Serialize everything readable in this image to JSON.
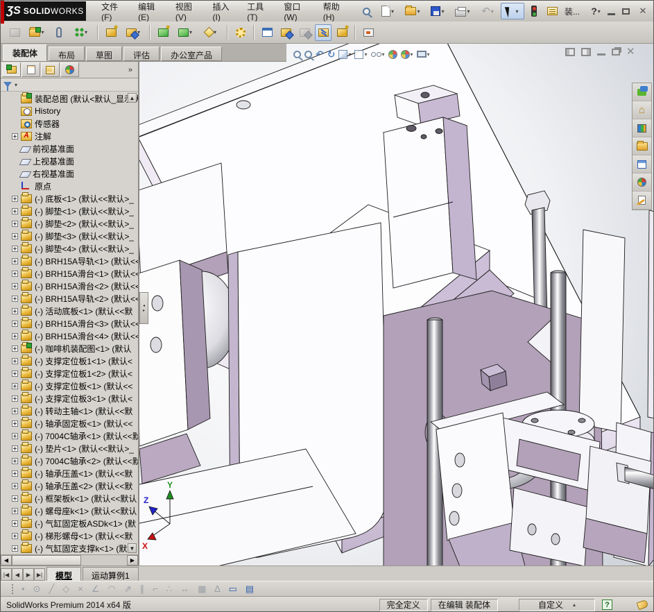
{
  "window": {
    "logo_glyph": "ƷS",
    "logo_brand_bold": "SOLID",
    "logo_brand_light": "WORKS",
    "accent_red": "#c20000",
    "doc_button_label": "装...",
    "help_label": "?"
  },
  "menu": {
    "items": [
      "文件(F)",
      "编辑(E)",
      "视图(V)",
      "插入(I)",
      "工具(T)",
      "窗口(W)",
      "帮助(H)"
    ]
  },
  "quick_toolbar": {
    "icons": [
      "new-document",
      "open",
      "save",
      "print",
      "undo",
      "select-cursor",
      "stoplight-toggle",
      "comment-note",
      "document-menu",
      "help"
    ]
  },
  "assembly_toolbar": {
    "icons": [
      "insert-component",
      "open-part",
      "mate",
      "linear-component-pattern",
      "smart-fasteners",
      "move-component",
      "show-hidden-components",
      "assembly-features",
      "reference-geometry",
      "new-motion-study",
      "bill-of-materials",
      "exploded-view",
      "explode-line-sketch",
      "large-assembly-mode",
      "appearances",
      "take-snapshot"
    ]
  },
  "command_tabs": {
    "items": [
      {
        "label": "装配体",
        "cls": "active"
      },
      {
        "label": "布局",
        "cls": ""
      },
      {
        "label": "草图",
        "cls": ""
      },
      {
        "label": "评估",
        "cls": ""
      },
      {
        "label": "办公室产品",
        "cls": ""
      }
    ]
  },
  "headsup": {
    "icons": [
      "zoom-to-fit",
      "zoom-to-area",
      "previous-view",
      "section-view",
      "view-orientation",
      "display-style",
      "hide-show-items",
      "edit-appearance",
      "apply-scene",
      "view-settings"
    ]
  },
  "doc_window_controls": [
    "split-left",
    "split-right",
    "minimize",
    "restore",
    "close"
  ],
  "feature_tree": {
    "pane_tabs": [
      "feature-manager",
      "property-manager",
      "configuration-manager",
      "display-manager"
    ],
    "more_label": "»",
    "items": [
      {
        "t": "asm",
        "label": "装配总图 (默认<默认_显示状态"
      },
      {
        "t": "hist",
        "label": "History"
      },
      {
        "t": "sens",
        "label": "传感器"
      },
      {
        "t": "ann",
        "plus": true,
        "label": "注解"
      },
      {
        "t": "plane",
        "label": "前视基准面"
      },
      {
        "t": "plane",
        "label": "上视基准面"
      },
      {
        "t": "plane",
        "label": "右视基准面"
      },
      {
        "t": "origin",
        "label": "原点"
      },
      {
        "t": "part",
        "plus": true,
        "label": "(-) 底板<1> (默认<<默认>_"
      },
      {
        "t": "part",
        "plus": true,
        "label": "(-) 脚垫<1> (默认<<默认>_"
      },
      {
        "t": "part",
        "plus": true,
        "label": "(-) 脚垫<2> (默认<<默认>_"
      },
      {
        "t": "part",
        "plus": true,
        "label": "(-) 脚垫<3> (默认<<默认>_"
      },
      {
        "t": "part",
        "plus": true,
        "label": "(-) 脚垫<4> (默认<<默认>_"
      },
      {
        "t": "part",
        "plus": true,
        "label": "(-) BRH15A导轨<1> (默认<<"
      },
      {
        "t": "part",
        "plus": true,
        "label": "(-) BRH15A滑台<1> (默认<<"
      },
      {
        "t": "part",
        "plus": true,
        "label": "(-) BRH15A滑台<2> (默认<<"
      },
      {
        "t": "part",
        "plus": true,
        "label": "(-) BRH15A导轨<2> (默认<<"
      },
      {
        "t": "part",
        "plus": true,
        "label": "(-) 活动底板<1> (默认<<默"
      },
      {
        "t": "part",
        "plus": true,
        "label": "(-) BRH15A滑台<3> (默认<<"
      },
      {
        "t": "part",
        "plus": true,
        "label": "(-) BRH15A滑台<4> (默认<<"
      },
      {
        "t": "asm",
        "plus": true,
        "label": "(-) 咖啡机装配图<1> (默认"
      },
      {
        "t": "part",
        "plus": true,
        "label": "(-) 支撑定位板1<1> (默认<"
      },
      {
        "t": "part",
        "plus": true,
        "label": "(-) 支撑定位板1<2> (默认<"
      },
      {
        "t": "part",
        "plus": true,
        "label": "(-) 支撑定位板<1> (默认<<"
      },
      {
        "t": "part",
        "plus": true,
        "label": "(-) 支撑定位板3<1> (默认<"
      },
      {
        "t": "part",
        "plus": true,
        "label": "(-) 转动主轴<1> (默认<<默"
      },
      {
        "t": "part",
        "plus": true,
        "label": "(-) 轴承固定板<1> (默认<<"
      },
      {
        "t": "part",
        "plus": true,
        "label": "(-) 7004C轴承<1> (默认<<默"
      },
      {
        "t": "part",
        "plus": true,
        "label": "(-) 垫片<1> (默认<<默认>_"
      },
      {
        "t": "part",
        "plus": true,
        "label": "(-) 7004C轴承<2> (默认<<默"
      },
      {
        "t": "part",
        "plus": true,
        "label": "(-) 轴承压盖<1> (默认<<默"
      },
      {
        "t": "part",
        "plus": true,
        "label": "(-) 轴承压盖<2> (默认<<默"
      },
      {
        "t": "part",
        "plus": true,
        "label": "(-) 框架板k<1> (默认<<默认"
      },
      {
        "t": "part",
        "plus": true,
        "label": "(-) 螺母座k<1> (默认<<默认"
      },
      {
        "t": "part",
        "plus": true,
        "label": "(-) 气缸固定板ASDk<1> (默"
      },
      {
        "t": "part",
        "plus": true,
        "label": "(-) 梯形螺母<1> (默认<<默"
      },
      {
        "t": "part",
        "plus": true,
        "label": "(-) 气缸固定支撑k<1> (默认"
      }
    ]
  },
  "taskpane": {
    "tabs": [
      "solidworks-forum",
      "solidworks-resources",
      "design-library",
      "file-explorer",
      "view-palette",
      "appearances-scenes",
      "custom-properties"
    ]
  },
  "doc_tabs": {
    "tabs": [
      {
        "label": "模型",
        "cls": "active"
      },
      {
        "label": "运动算例1",
        "cls": ""
      }
    ]
  },
  "sketch_bar": {
    "icons": [
      {
        "g": "•",
        "cls": ""
      },
      {
        "g": "⊙",
        "cls": ""
      },
      {
        "g": "╱",
        "cls": ""
      },
      {
        "g": "◇",
        "cls": ""
      },
      {
        "g": "×",
        "cls": ""
      },
      {
        "g": "∠",
        "cls": ""
      },
      {
        "g": "◠",
        "cls": ""
      },
      {
        "g": "⇗",
        "cls": ""
      },
      {
        "g": "∥",
        "cls": ""
      },
      {
        "g": "⌐",
        "cls": ""
      },
      {
        "g": "∴",
        "cls": ""
      },
      {
        "g": "↔",
        "cls": ""
      },
      {
        "g": "▦",
        "cls": ""
      },
      {
        "g": "∆",
        "cls": ""
      },
      {
        "g": "▭",
        "cls": "blue"
      },
      {
        "g": "▤",
        "cls": "blue"
      }
    ]
  },
  "status_bar": {
    "left": "SolidWorks Premium 2014 x64 版",
    "define_state": "完全定义",
    "editing_state": "在编辑 装配体",
    "custom": "自定义",
    "help": "?"
  },
  "viewport": {
    "model_color": "#b3a2b8",
    "selected_edge_color": "#ff8300",
    "triad": {
      "x": "X",
      "y": "Y",
      "z": "Z"
    }
  }
}
